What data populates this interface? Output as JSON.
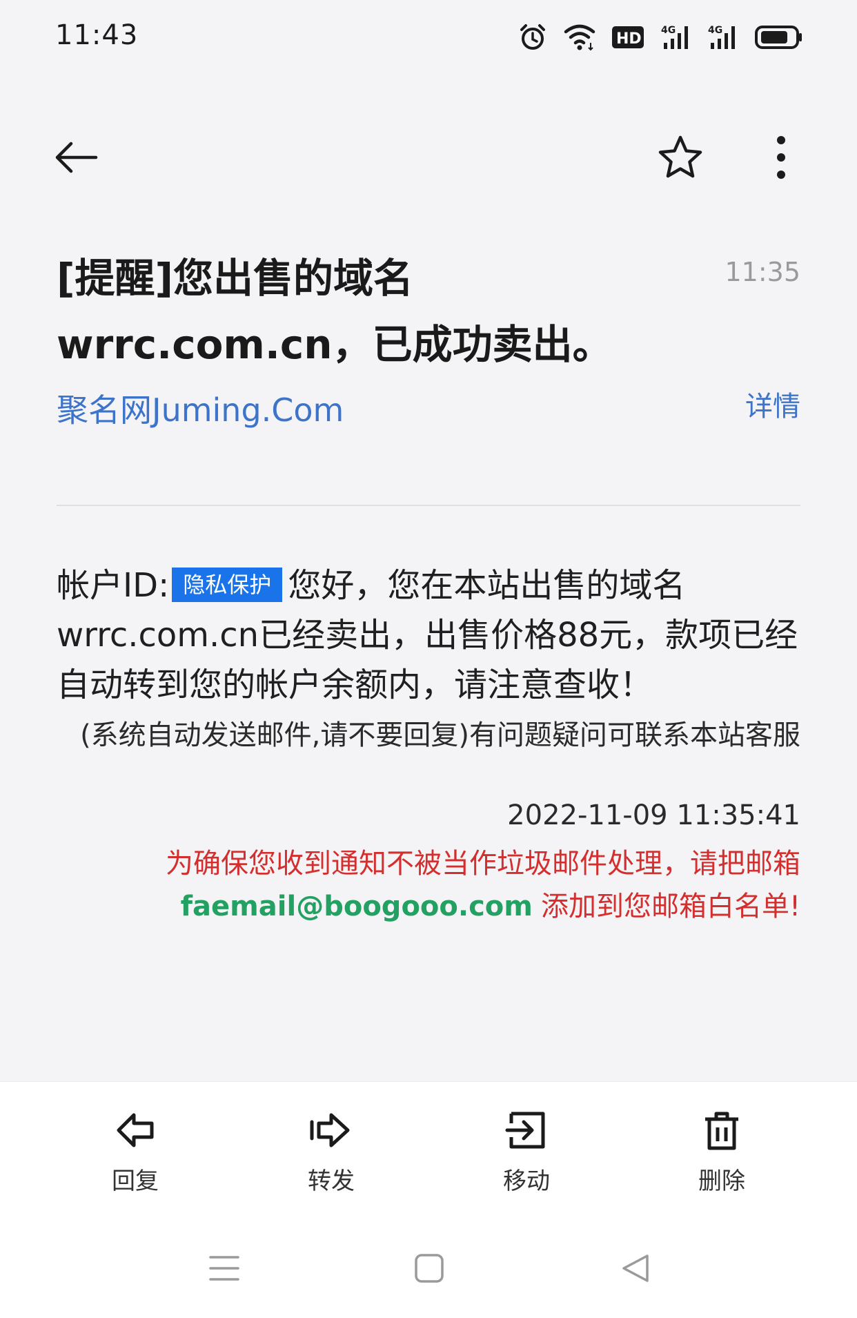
{
  "status_bar": {
    "time": "11:43",
    "icons": [
      "alarm-icon",
      "wifi-icon",
      "hd-icon",
      "signal-4g-icon",
      "signal-4g-icon",
      "battery-icon"
    ]
  },
  "toolbar": {
    "back_icon": "arrow-left-icon",
    "star_icon": "star-outline-icon",
    "more_icon": "more-vertical-icon"
  },
  "email": {
    "subject_line1": "[提醒]您出售的域名",
    "subject_line2": "wrrc.com.cn，已成功卖出。",
    "received_time": "11:35",
    "sender": "聚名网Juming.Com",
    "details_label": "详情",
    "body": {
      "account_label": "帐户ID:",
      "privacy_badge": "隐私保护",
      "main_text": "您好，您在本站出售的域名wrrc.com.cn已经卖出，出售价格88元，款项已经自动转到您的帐户余额内，请注意查收！",
      "auto_note": "(系统自动发送邮件,请不要回复)有问题疑问可联系本站客服",
      "sent_datetime": "2022-11-09 11:35:41",
      "whitelist_line1": "为确保您收到通知不被当作垃圾邮件处理，请把邮箱",
      "sender_address": "faemail@boogooo.com",
      "whitelist_line2": "添加到您邮箱白名单!"
    }
  },
  "actions": [
    {
      "label": "回复",
      "icon": "reply-icon"
    },
    {
      "label": "转发",
      "icon": "forward-icon"
    },
    {
      "label": "移动",
      "icon": "move-icon"
    },
    {
      "label": "删除",
      "icon": "trash-icon"
    }
  ],
  "nav_bar": {
    "menu_icon": "menu-icon",
    "home_icon": "home-icon",
    "back_icon": "nav-back-icon"
  },
  "colors": {
    "link": "#3d73c9",
    "badge": "#1a73e8",
    "warning": "#d32f2f",
    "address": "#23a162"
  }
}
